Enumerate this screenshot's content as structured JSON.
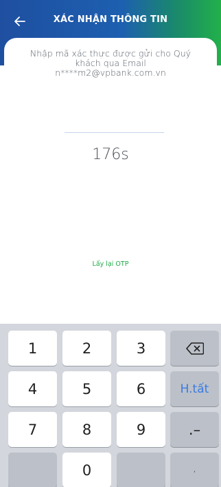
{
  "header": {
    "title": "XÁC NHẬN THÔNG TIN",
    "back_icon": "arrow-left-icon",
    "gradient_colors": [
      "#1f4fa0",
      "#22b04a"
    ]
  },
  "main": {
    "message_line1": "Nhập mã xác thực được gửi cho Quý",
    "message_line2": "khách qua Email",
    "message_email": "n****m2@vpbank.com.vn",
    "otp_value": "",
    "countdown": "176s",
    "resend_label": "Lấy lại OTP",
    "resend_color": "#23a94a"
  },
  "keyboard": {
    "keys": {
      "k1": "1",
      "k2": "2",
      "k3": "3",
      "k4": "4",
      "k5": "5",
      "k6": "6",
      "k7": "7",
      "k8": "8",
      "k9": "9",
      "k0": "0",
      "done": "H.tất",
      "dot_dash": ".–",
      "comma": ","
    },
    "backspace_icon": "backspace-icon",
    "accent_color": "#3a7be0"
  }
}
